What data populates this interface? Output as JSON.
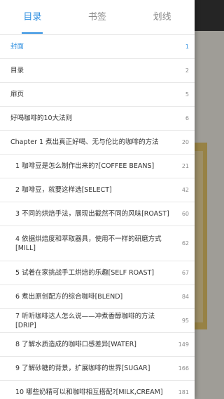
{
  "tabs": [
    {
      "label": "目录",
      "active": true
    },
    {
      "label": "书签",
      "active": false
    },
    {
      "label": "划线",
      "active": false
    }
  ],
  "toc": [
    {
      "title": "封面",
      "page": "1",
      "current": true
    },
    {
      "title": "目录",
      "page": "2"
    },
    {
      "title": "扉页",
      "page": "5"
    },
    {
      "title": "好喝咖啡的10大法则",
      "page": "6"
    },
    {
      "title": "Chapter 1 煮出真正好喝、无与伦比的咖啡的方法",
      "page": "20"
    },
    {
      "title": "1 咖啡豆是怎么制作出来的?[COFFEE BEANS]",
      "page": "21"
    },
    {
      "title": "2 咖啡豆，就要这样选[SELECT]",
      "page": "42"
    },
    {
      "title": "3 不同的烘焙手法，展现出截然不同的风味[ROAST]",
      "page": "60"
    },
    {
      "title": "4 依据烘焙度和萃取器具，使用不一样的研磨方式[MILL]",
      "page": "62"
    },
    {
      "title": "5 试着在家挑战手工烘焙的乐趣[SELF ROAST]",
      "page": "67"
    },
    {
      "title": "6 煮出原创配方的综合咖啡[BLEND]",
      "page": "84"
    },
    {
      "title": "7 听听咖啡达人怎么说——冲煮香醇咖啡的方法[DRIP]",
      "page": "95"
    },
    {
      "title": "8 了解水质造成的咖啡口感差异[WATER]",
      "page": "149"
    },
    {
      "title": "9 了解砂糖的背景，扩展咖啡的世界[SUGAR]",
      "page": "166"
    },
    {
      "title": "10 哪些奶精可以和咖啡相互搭配?[MILK,CREAM]",
      "page": "181"
    }
  ],
  "colors": {
    "accent": "#2f8fe0",
    "text": "#333333",
    "muted": "#8a8a8a"
  }
}
